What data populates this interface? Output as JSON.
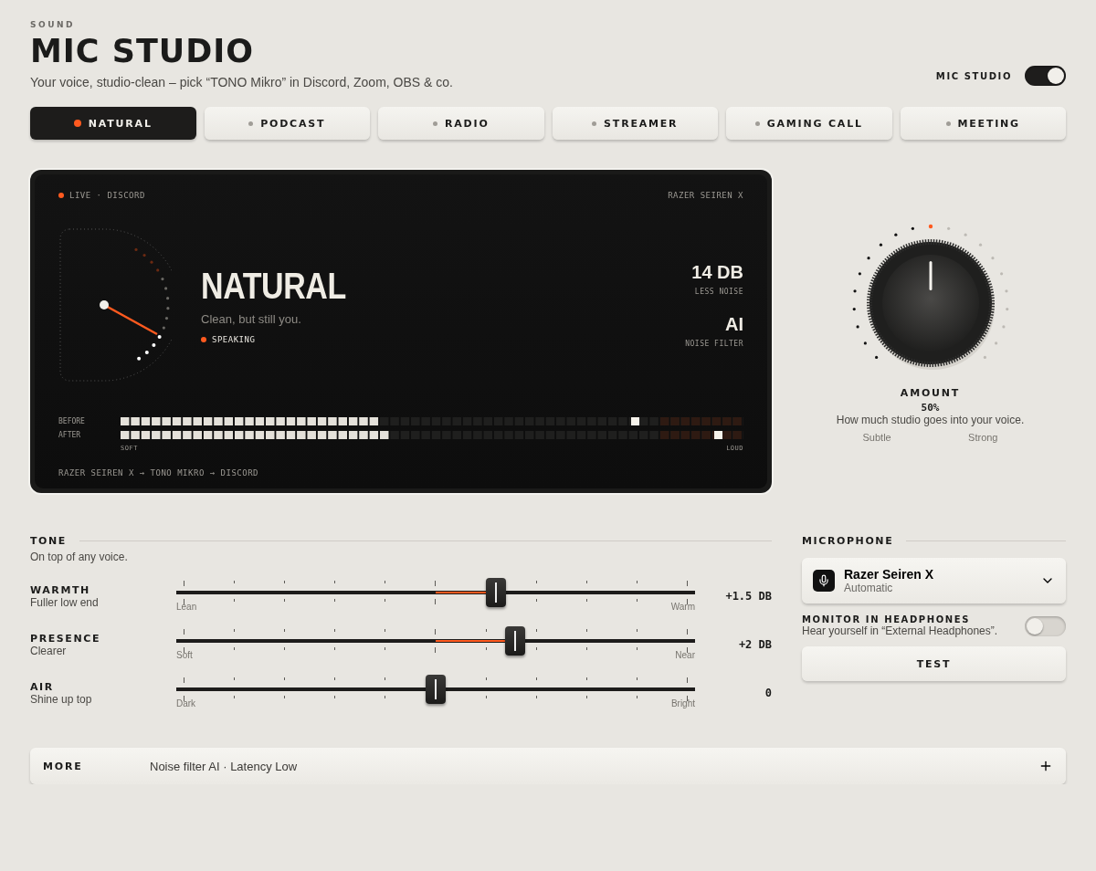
{
  "header": {
    "eyebrow": "SOUND",
    "title": "MIC STUDIO",
    "subtitle": "Your voice, studio-clean – pick “TONO Mikro” in Discord, Zoom, OBS & co.",
    "master_toggle": {
      "label": "MIC STUDIO",
      "on": true
    }
  },
  "presets": [
    {
      "label": "NATURAL",
      "selected": true
    },
    {
      "label": "PODCAST",
      "selected": false
    },
    {
      "label": "RADIO",
      "selected": false
    },
    {
      "label": "STREAMER",
      "selected": false
    },
    {
      "label": "GAMING CALL",
      "selected": false
    },
    {
      "label": "MEETING",
      "selected": false
    }
  ],
  "monitor_panel": {
    "status": "LIVE · DISCORD",
    "live": true,
    "device": "RAZER SEIREN X",
    "preset_name": "NATURAL",
    "preset_description": "Clean, but still you.",
    "activity": "SPEAKING",
    "stats": [
      {
        "value": "14 DB",
        "label": "LESS NOISE"
      },
      {
        "value": "AI",
        "label": "NOISE FILTER"
      }
    ],
    "meters": [
      {
        "label": "BEFORE",
        "level": 0.417,
        "peak": {
          "level": 0.833
        }
      },
      {
        "label": "AFTER",
        "level": 0.433,
        "peak": {
          "level": 0.967
        }
      }
    ],
    "scale_min": "SOFT",
    "scale_max": "LOUD",
    "chain": "RAZER SEIREN X → TONO MIKRO → DISCORD"
  },
  "amount": {
    "label": "AMOUNT",
    "reading": "50%",
    "description": "How much studio goes into your voice.",
    "min_label": "Subtle",
    "max_label": "Strong"
  },
  "tone": {
    "title": "TONE",
    "subtitle": "On top of any voice.",
    "sliders": [
      {
        "name": "WARMTH",
        "description": "Fuller low end",
        "min_label": "Lean",
        "max_label": "Warm",
        "reading": "+1.5 DB"
      },
      {
        "name": "PRESENCE",
        "description": "Clearer",
        "min_label": "Soft",
        "max_label": "Near",
        "reading": "+2 DB"
      },
      {
        "name": "AIR",
        "description": "Shine up top",
        "min_label": "Dark",
        "max_label": "Bright",
        "reading": "0"
      }
    ]
  },
  "microphone": {
    "title": "MICROPHONE",
    "device": {
      "name": "Razer Seiren X",
      "mode": "Automatic"
    },
    "monitor": {
      "label": "MONITOR IN HEADPHONES",
      "description": "Hear yourself in “External Headphones”.",
      "on": false
    },
    "test_button": "TEST"
  },
  "more": {
    "label": "MORE",
    "summary": "Noise filter AI · Latency Low",
    "expanded": false
  }
}
